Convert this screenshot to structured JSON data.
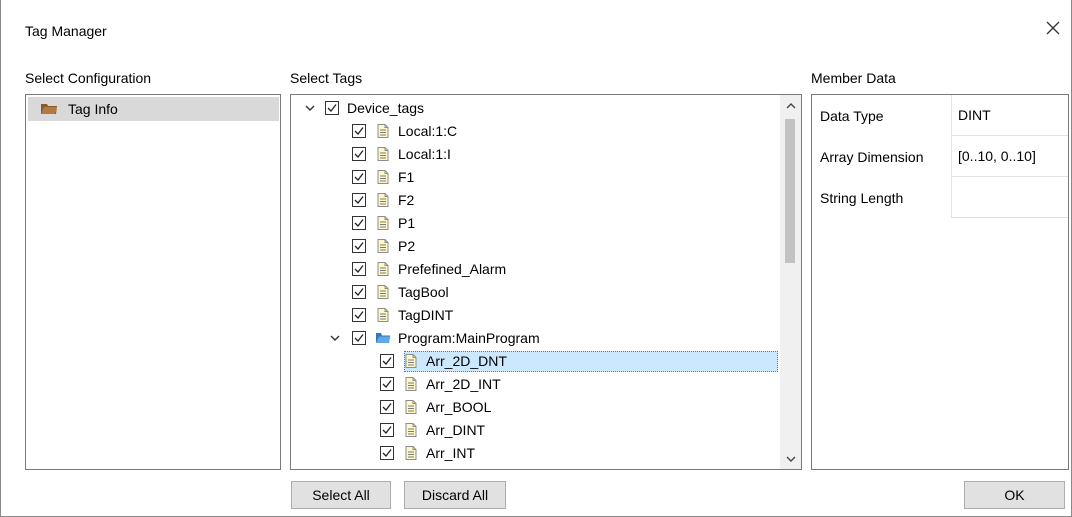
{
  "window": {
    "title": "Tag Manager"
  },
  "sections": {
    "config": "Select Configuration",
    "tags": "Select Tags",
    "member": "Member Data"
  },
  "config_items": [
    {
      "label": "Tag Info",
      "icon": "folder-icon"
    }
  ],
  "tags_tree": [
    {
      "label": "Device_tags",
      "level": 0,
      "expanded": true,
      "checked": true,
      "icon": "none"
    },
    {
      "label": "Local:1:C",
      "level": 1,
      "checked": true,
      "icon": "tag-icon"
    },
    {
      "label": "Local:1:I",
      "level": 1,
      "checked": true,
      "icon": "tag-icon"
    },
    {
      "label": "F1",
      "level": 1,
      "checked": true,
      "icon": "tag-icon"
    },
    {
      "label": "F2",
      "level": 1,
      "checked": true,
      "icon": "tag-icon"
    },
    {
      "label": "P1",
      "level": 1,
      "checked": true,
      "icon": "tag-icon"
    },
    {
      "label": "P2",
      "level": 1,
      "checked": true,
      "icon": "tag-icon"
    },
    {
      "label": "Prefefined_Alarm",
      "level": 1,
      "checked": true,
      "icon": "tag-icon"
    },
    {
      "label": "TagBool",
      "level": 1,
      "checked": true,
      "icon": "tag-icon"
    },
    {
      "label": "TagDINT",
      "level": 1,
      "checked": true,
      "icon": "tag-icon"
    },
    {
      "label": "Program:MainProgram",
      "level": 1,
      "expanded": true,
      "checked": true,
      "icon": "folder-icon"
    },
    {
      "label": "Arr_2D_DNT",
      "level": 2,
      "checked": true,
      "icon": "tag-icon",
      "selected": true
    },
    {
      "label": "Arr_2D_INT",
      "level": 2,
      "checked": true,
      "icon": "tag-icon"
    },
    {
      "label": "Arr_BOOL",
      "level": 2,
      "checked": true,
      "icon": "tag-icon"
    },
    {
      "label": "Arr_DINT",
      "level": 2,
      "checked": true,
      "icon": "tag-icon"
    },
    {
      "label": "Arr_INT",
      "level": 2,
      "checked": true,
      "icon": "tag-icon"
    }
  ],
  "member_data": [
    {
      "key": "Data Type",
      "value": "DINT"
    },
    {
      "key": "Array Dimension",
      "value": "[0..10, 0..10]"
    },
    {
      "key": "String Length",
      "value": ""
    }
  ],
  "buttons": {
    "select_all": "Select All",
    "discard_all": "Discard All",
    "ok": "OK"
  }
}
